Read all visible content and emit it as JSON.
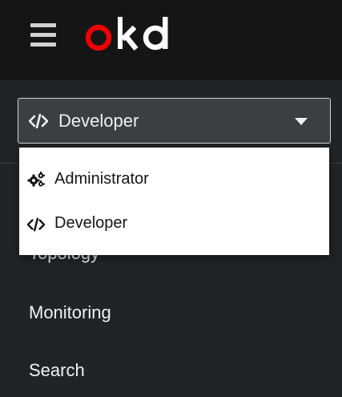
{
  "masthead": {
    "menu_icon": "hamburger-menu-icon",
    "logo_text": "okd",
    "logo_colors": {
      "o": "#ee0000",
      "kd": "#ffffff"
    }
  },
  "perspective_switcher": {
    "icon": "code-icon",
    "selected": "Developer",
    "caret_icon": "caret-down-icon",
    "options": [
      {
        "label": "Administrator",
        "icon": "cogs-icon"
      },
      {
        "label": "Developer",
        "icon": "code-icon"
      }
    ]
  },
  "nav": {
    "items": [
      {
        "label": "Topology"
      },
      {
        "label": "Monitoring"
      },
      {
        "label": "Search"
      }
    ]
  },
  "colors": {
    "masthead_bg": "#151515",
    "sidebar_bg": "#212427",
    "switcher_bg": "#3c3f42",
    "brand_red": "#ee0000"
  }
}
